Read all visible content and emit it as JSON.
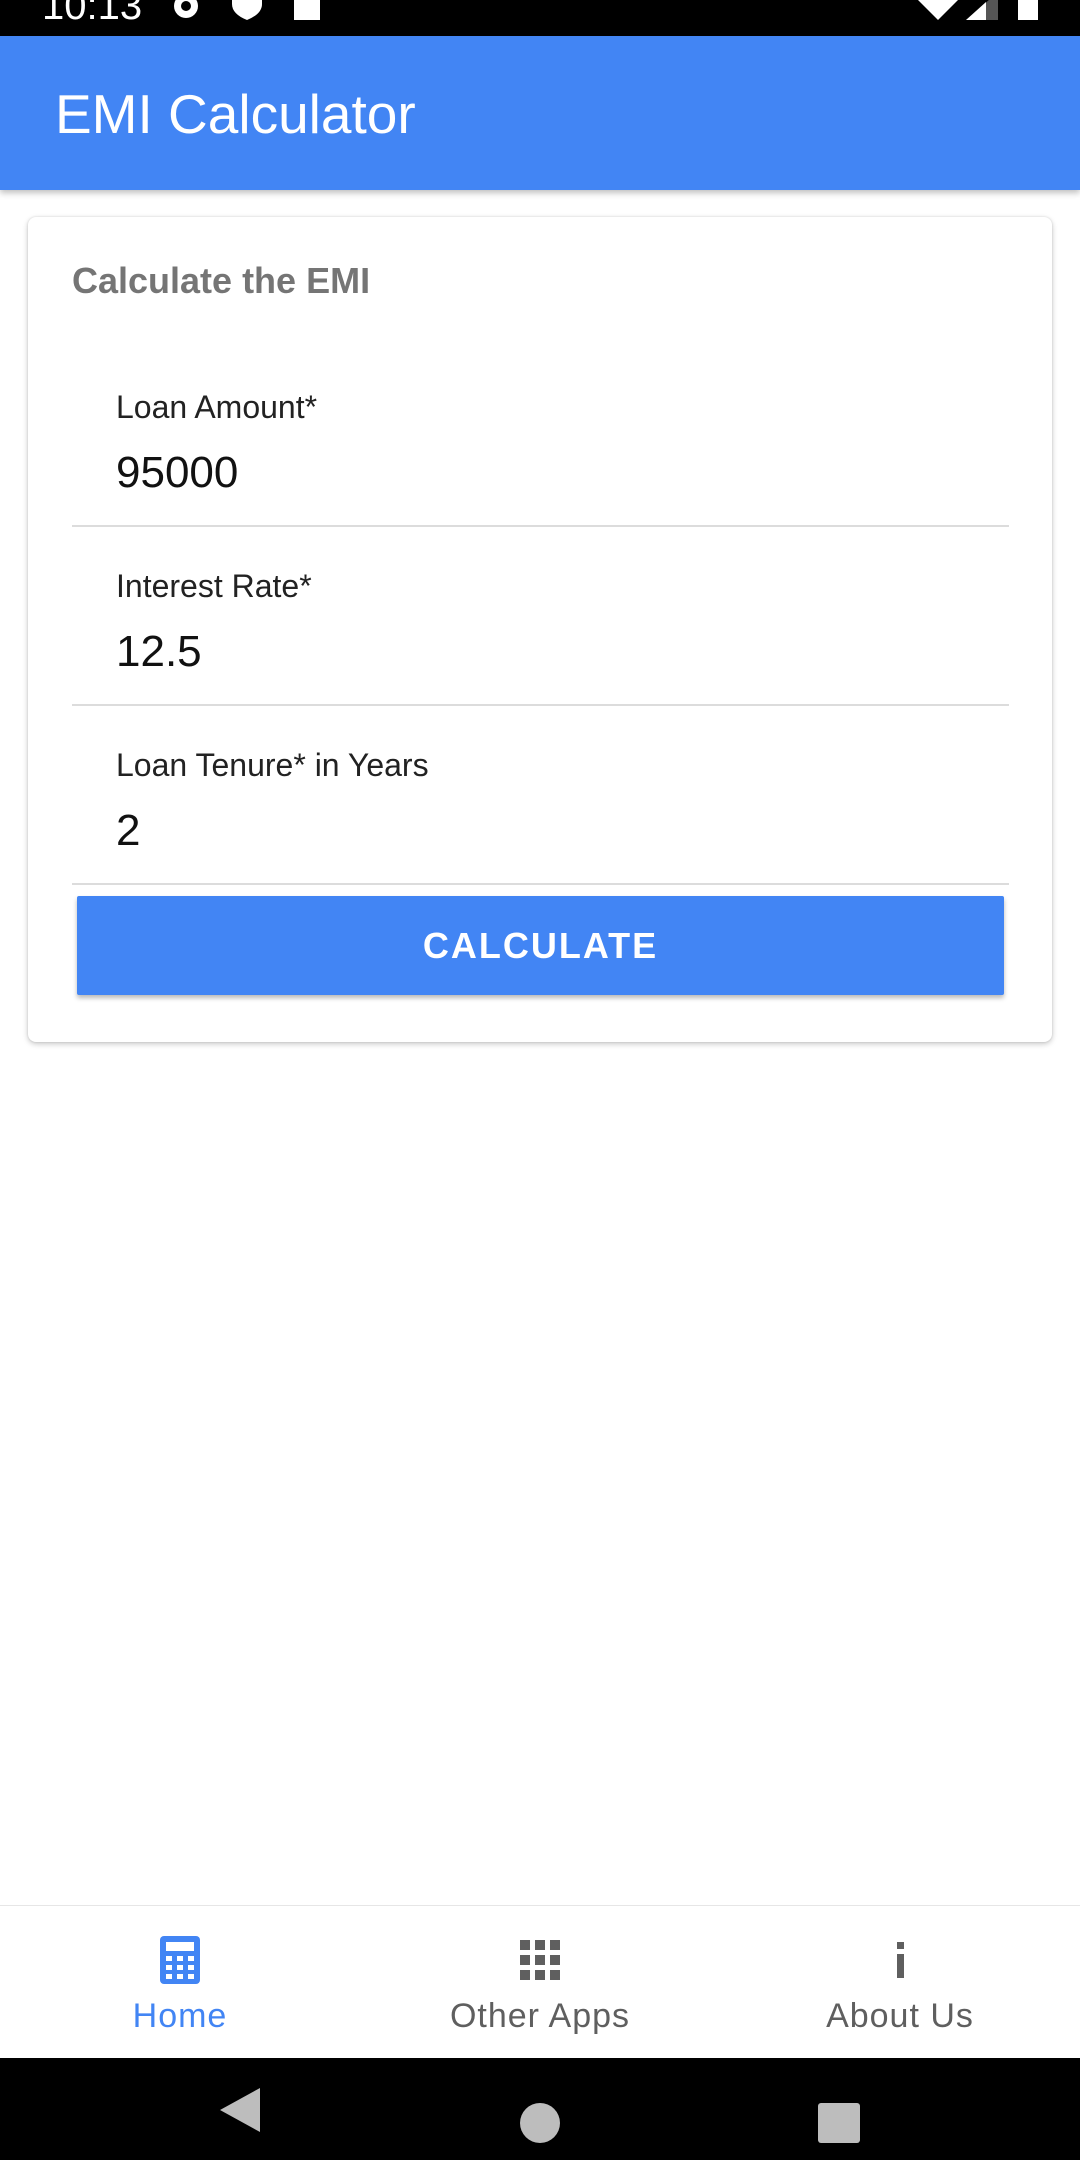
{
  "status_bar": {
    "time": "10:13",
    "icons": [
      "settings-icon",
      "shield-icon",
      "sd-card-icon",
      "wifi-icon",
      "cell-signal-icon",
      "battery-icon"
    ]
  },
  "app_bar": {
    "title": "EMI Calculator",
    "color": "#4285f4"
  },
  "card": {
    "title": "Calculate the EMI",
    "fields": [
      {
        "label": "Loan Amount*",
        "value": "95000"
      },
      {
        "label": "Interest Rate*",
        "value": "12.5"
      },
      {
        "label": "Loan Tenure* in Years",
        "value": "2"
      }
    ],
    "button_label": "CALCULATE"
  },
  "bottom_nav": {
    "items": [
      {
        "label": "Home",
        "icon": "calculator-icon",
        "active": true
      },
      {
        "label": "Other Apps",
        "icon": "apps-grid-icon",
        "active": false
      },
      {
        "label": "About Us",
        "icon": "info-icon",
        "active": false
      }
    ]
  },
  "system_nav": {
    "icons": [
      "back-icon",
      "home-circle-icon",
      "recents-square-icon"
    ]
  }
}
